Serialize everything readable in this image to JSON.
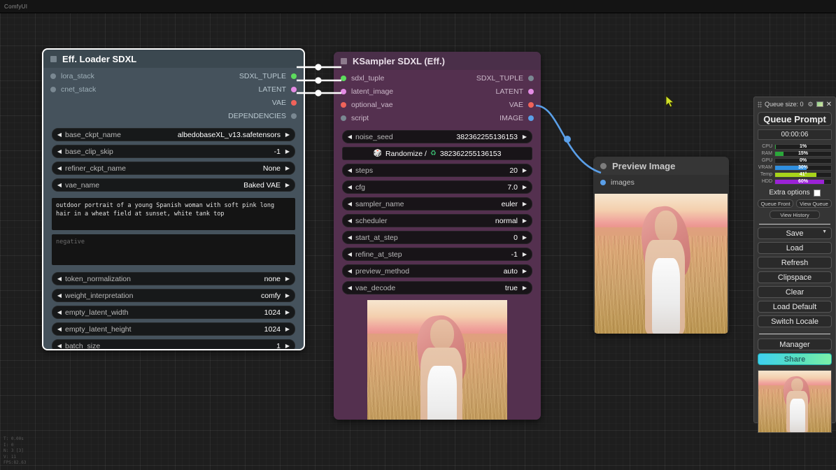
{
  "titlebar": {
    "text": "ComfyUI"
  },
  "nodes": {
    "loader": {
      "title": "Eff. Loader SDXL",
      "inputs": [
        {
          "label": "lora_stack",
          "color": "#7a8892"
        },
        {
          "label": "cnet_stack",
          "color": "#7a8892"
        }
      ],
      "outputs": [
        {
          "label": "SDXL_TUPLE",
          "color": "#5ddc5d"
        },
        {
          "label": "LATENT",
          "color": "#e48ce4"
        },
        {
          "label": "VAE",
          "color": "#f0635a"
        },
        {
          "label": "DEPENDENCIES",
          "color": "#7a8892"
        }
      ],
      "widgets": [
        {
          "name": "base_ckpt_name",
          "value": "albedobaseXL_v13.safetensors"
        },
        {
          "name": "base_clip_skip",
          "value": "-1"
        },
        {
          "name": "refiner_ckpt_name",
          "value": "None"
        },
        {
          "name": "vae_name",
          "value": "Baked VAE"
        }
      ],
      "positive_prompt": "outdoor portrait of a young Spanish woman with soft pink long hair in a wheat field at sunset, white tank top",
      "negative_placeholder": "negative",
      "widgets2": [
        {
          "name": "token_normalization",
          "value": "none"
        },
        {
          "name": "weight_interpretation",
          "value": "comfy"
        },
        {
          "name": "empty_latent_width",
          "value": "1024"
        },
        {
          "name": "empty_latent_height",
          "value": "1024"
        },
        {
          "name": "batch_size",
          "value": "1"
        }
      ]
    },
    "ksampler": {
      "title": "KSampler SDXL (Eff.)",
      "inputs": [
        {
          "label": "sdxl_tuple",
          "color": "#5ddc5d"
        },
        {
          "label": "latent_image",
          "color": "#e48ce4"
        },
        {
          "label": "optional_vae",
          "color": "#f0635a"
        },
        {
          "label": "script",
          "color": "#7a8892"
        }
      ],
      "outputs": [
        {
          "label": "SDXL_TUPLE",
          "color": "#7a8892"
        },
        {
          "label": "LATENT",
          "color": "#e48ce4"
        },
        {
          "label": "VAE",
          "color": "#f0635a"
        },
        {
          "label": "IMAGE",
          "color": "#5a9fe8"
        }
      ],
      "seed_widget": {
        "name": "noise_seed",
        "value": "382362255136153"
      },
      "randomize_row": {
        "dice_icon": "dice-icon",
        "label": "Randomize /",
        "recycle_icon": "recycle-icon",
        "value": "382362255136153"
      },
      "widgets": [
        {
          "name": "steps",
          "value": "20"
        },
        {
          "name": "cfg",
          "value": "7.0"
        },
        {
          "name": "sampler_name",
          "value": "euler"
        },
        {
          "name": "scheduler",
          "value": "normal"
        },
        {
          "name": "start_at_step",
          "value": "0"
        },
        {
          "name": "refine_at_step",
          "value": "-1"
        },
        {
          "name": "preview_method",
          "value": "auto"
        },
        {
          "name": "vae_decode",
          "value": "true"
        }
      ]
    },
    "preview": {
      "title": "Preview Image",
      "inputs": [
        {
          "label": "images",
          "color": "#5a9fe8"
        }
      ]
    }
  },
  "queue_panel": {
    "header": "Queue size: 0",
    "icons": [
      "gear-icon",
      "screen-icon",
      "close-icon"
    ],
    "queue_prompt_label": "Queue Prompt",
    "timer": "00:00:06",
    "resources": [
      {
        "label": "CPU",
        "value": "1%",
        "pct": 1,
        "color": "#2aa83a"
      },
      {
        "label": "RAM",
        "value": "15%",
        "pct": 15,
        "color": "#2aa83a"
      },
      {
        "label": "GPU",
        "value": "0%",
        "pct": 0,
        "color": "#2aa83a"
      },
      {
        "label": "VRAM",
        "value": "30%",
        "pct": 30,
        "color": "#2f8fe0"
      },
      {
        "label": "Temp",
        "value": "41°",
        "pct": 41,
        "color": "#a8d41a"
      },
      {
        "label": "HDD",
        "value": "60%",
        "pct": 60,
        "color": "#9b22d6"
      }
    ],
    "extra_options_label": "Extra options",
    "small_buttons": [
      "Queue Front",
      "View Queue"
    ],
    "view_history_label": "View History",
    "workflow_buttons": [
      "Save",
      "Load",
      "Refresh",
      "Clipspace",
      "Clear",
      "Load Default",
      "Switch Locale"
    ],
    "manager_label": "Manager",
    "share_label": "Share"
  },
  "perf_overlay": {
    "line1": "T: 0.00s",
    "line2": "I: 0",
    "line3": "N: 3 [3]",
    "line4": "V: 11",
    "line5": "FPS:82.63"
  },
  "colors": {
    "loader_body": "#45525c",
    "ksampler_body": "#54304f",
    "link_white": "#ffffff",
    "link_blue": "#5a9fe8",
    "share_accent": "#58e0c0"
  }
}
